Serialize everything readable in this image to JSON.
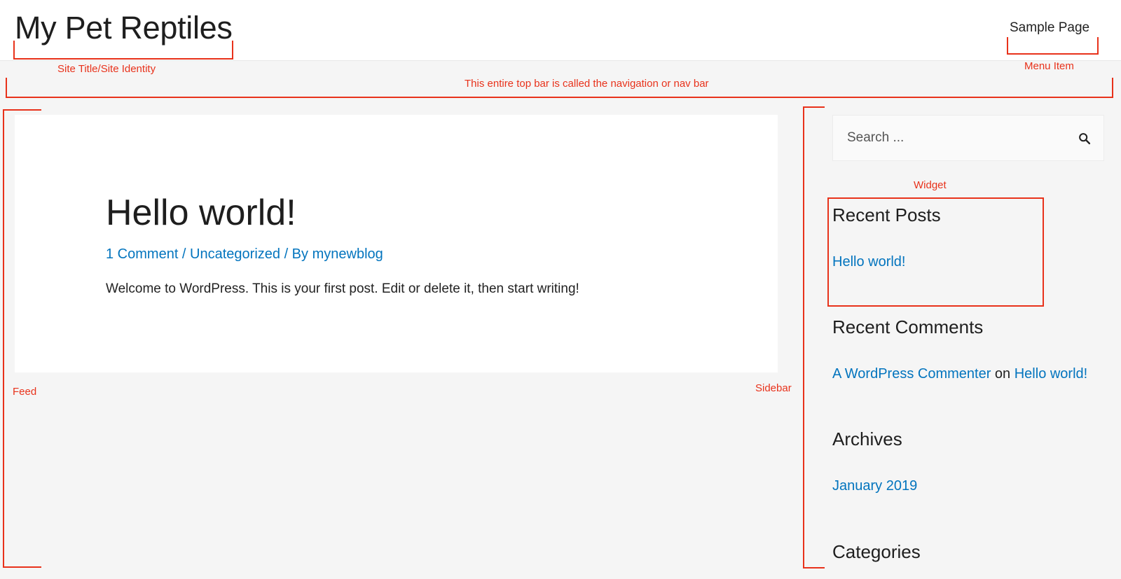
{
  "header": {
    "site_title": "My Pet Reptiles",
    "menu_item": "Sample Page"
  },
  "post": {
    "title": "Hello world!",
    "meta": {
      "comments": "1 Comment",
      "sep1": " / ",
      "category": "Uncategorized",
      "sep2": " / By ",
      "author": "mynewblog"
    },
    "excerpt": "Welcome to WordPress. This is your first post. Edit or delete it, then start writing!"
  },
  "sidebar": {
    "search": {
      "placeholder": "Search ...",
      "icon": "search-icon"
    },
    "recent_posts": {
      "title": "Recent Posts",
      "items": [
        "Hello world!"
      ]
    },
    "recent_comments": {
      "title": "Recent Comments",
      "items": [
        {
          "author": "A WordPress Commenter",
          "connector": " on ",
          "post": "Hello world!"
        }
      ]
    },
    "archives": {
      "title": "Archives",
      "items": [
        "January 2019"
      ]
    },
    "categories": {
      "title": "Categories"
    }
  },
  "annotations": {
    "site_identity": "Site Title/Site Identity",
    "menu_item": "Menu Item",
    "nav_bar": "This entire top bar is called the navigation or nav bar",
    "widget": "Widget",
    "feed": "Feed",
    "sidebar": "Sidebar"
  },
  "colors": {
    "link": "#0274be",
    "annotation": "#e8321b",
    "page_background": "#f5f5f5",
    "card_background": "#ffffff"
  }
}
